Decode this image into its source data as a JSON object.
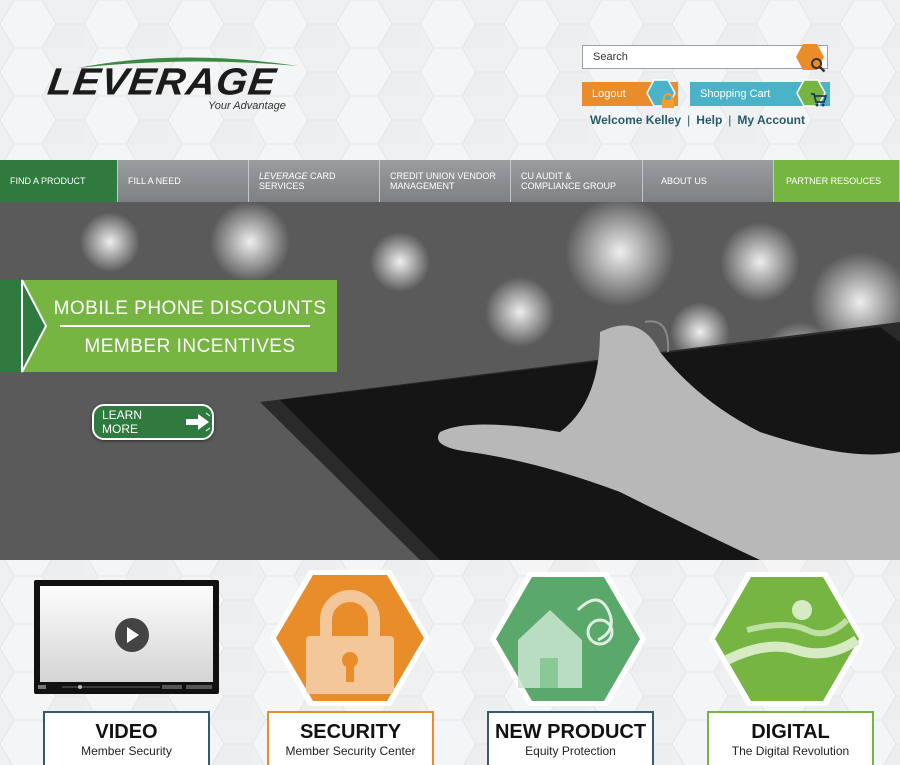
{
  "header": {
    "logo_text": "LEVERAGE",
    "tagline": "Your Advantage",
    "search_placeholder": "Search",
    "logout_label": "Logout",
    "cart_label": "Shopping Cart",
    "welcome": "Welcome Kelley",
    "help": "Help",
    "my_account": "My Account"
  },
  "nav": {
    "items": [
      {
        "label": "FIND A PRODUCT"
      },
      {
        "label": "FILL A NEED"
      },
      {
        "label_italic": "LEVERAGE",
        "label": " CARD SERVICES"
      },
      {
        "label": "CREDIT UNION VENDOR MANAGEMENT"
      },
      {
        "label": "CU AUDIT & COMPLIANCE GROUP"
      },
      {
        "label": "ABOUT US"
      },
      {
        "label": "PARTNER RESOUCES"
      }
    ]
  },
  "hero": {
    "line1": "MOBILE PHONE DISCOUNTS",
    "line2": "MEMBER INCENTIVES",
    "cta": "LEARN MORE"
  },
  "tiles": [
    {
      "title": "VIDEO",
      "subtitle": "Member Security",
      "border": "#355a6b"
    },
    {
      "title": "SECURITY",
      "subtitle": "Member Security Center",
      "border": "#e88d2a"
    },
    {
      "title": "NEW PRODUCT",
      "subtitle": "Equity Protection",
      "border": "#355a6b"
    },
    {
      "title": "DIGITAL",
      "subtitle": "The Digital Revolution",
      "border": "#76b542"
    }
  ],
  "colors": {
    "green_dark": "#2f7a3e",
    "green_light": "#76b542",
    "orange": "#e88d2a",
    "teal": "#4bb3c7",
    "nav_gray": "#8a8d8f"
  }
}
